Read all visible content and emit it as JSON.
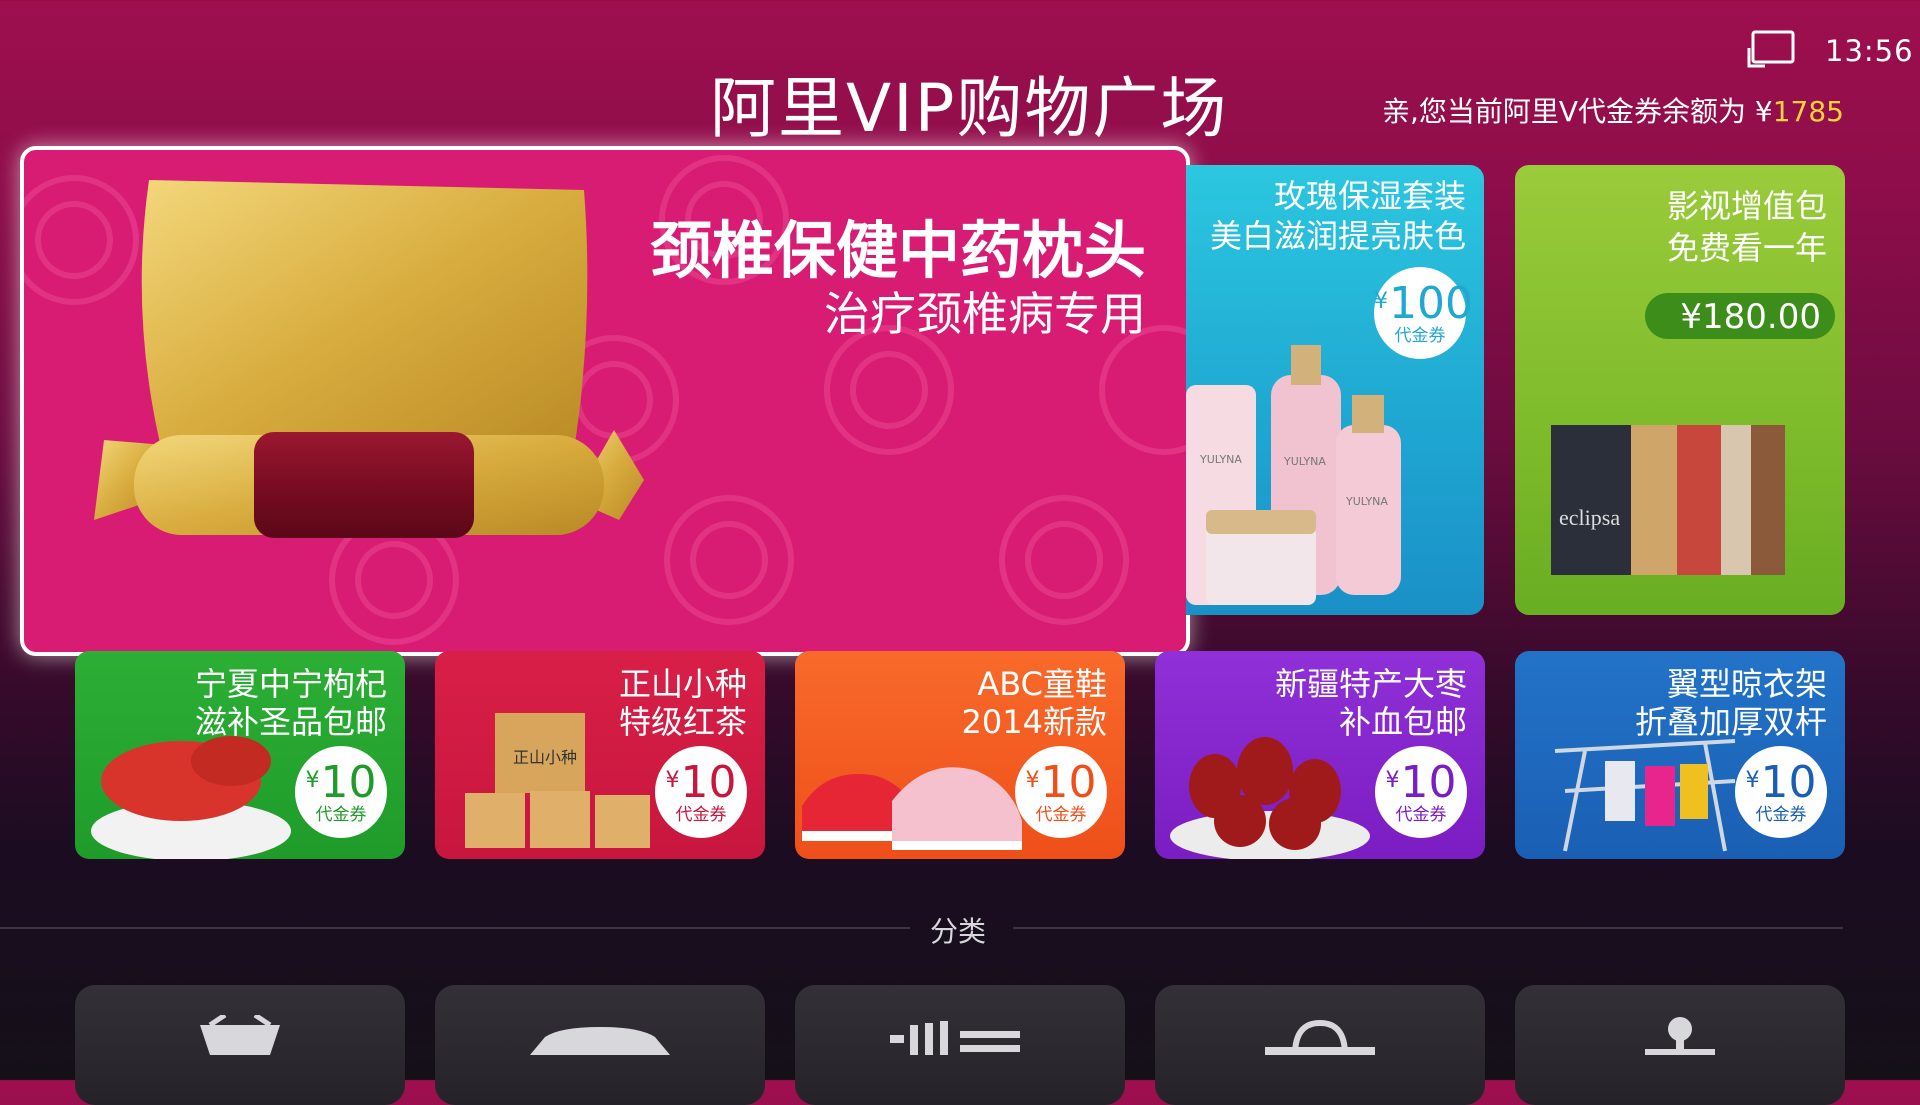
{
  "status": {
    "time": "13:56",
    "icon": "tv-screen-icon"
  },
  "header": {
    "title": "阿里VIP购物广场",
    "balance_prefix": "亲,您当前阿里V代金券余额为 ¥",
    "balance_amount": "1785"
  },
  "featured": {
    "title": "颈椎保健中药枕头",
    "subtitle": "治疗颈椎病专用",
    "color": "#d81b73"
  },
  "cosmetics": {
    "line1": "玫瑰保湿套装",
    "line2": "美白滋润提亮肤色",
    "coupon_symbol": "¥",
    "coupon_value": "100",
    "coupon_label": "代金券",
    "product_labels": [
      "YULYNA",
      "YULYNA",
      "YULYNA"
    ]
  },
  "video": {
    "line1": "影视增值包",
    "line2": "免费看一年",
    "price": "¥180.00",
    "poster_text": "eclipsa"
  },
  "products": [
    {
      "line1": "宁夏中宁枸杞",
      "line2": "滋补圣品包邮",
      "coupon_symbol": "¥",
      "coupon_value": "10",
      "coupon_label": "代金券",
      "color": "#1f9b2a"
    },
    {
      "line1": "正山小种",
      "line2": "特级红茶",
      "coupon_symbol": "¥",
      "coupon_value": "10",
      "coupon_label": "代金券",
      "color": "#c8163e",
      "box_text": "正山小种"
    },
    {
      "line1": "ABC童鞋",
      "line2": "2014新款",
      "coupon_symbol": "¥",
      "coupon_value": "10",
      "coupon_label": "代金券",
      "color": "#f0561e"
    },
    {
      "line1": "新疆特产大枣",
      "line2": "补血包邮",
      "coupon_symbol": "¥",
      "coupon_value": "10",
      "coupon_label": "代金券",
      "color": "#8120c9"
    },
    {
      "line1": "翼型晾衣架",
      "line2": "折叠加厚双杆",
      "coupon_symbol": "¥",
      "coupon_value": "10",
      "coupon_label": "代金券",
      "color": "#1a5fb4"
    }
  ],
  "categories": {
    "label": "分类",
    "items": [
      {
        "icon": "basket-icon"
      },
      {
        "icon": "car-icon"
      },
      {
        "icon": "speed-lines-icon"
      },
      {
        "icon": "shopping-bag-icon"
      },
      {
        "icon": "joystick-icon"
      }
    ]
  }
}
